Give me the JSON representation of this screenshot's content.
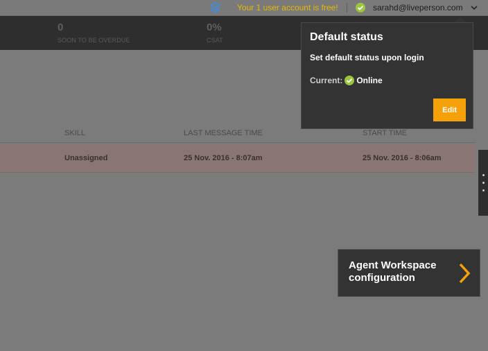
{
  "topbar": {
    "promo_text": "Your 1 user account is free!",
    "user_email": "sarahd@liveperson.com",
    "status_color": "#9bc53d",
    "icons": [
      "layers-icon",
      "status-check-icon",
      "chevron-down-icon"
    ]
  },
  "kpis": [
    {
      "value": "0",
      "label": "SOON TO BE OVERDUE"
    },
    {
      "value": "0%",
      "label": "CSAT"
    }
  ],
  "table": {
    "headers": [
      "SKILL",
      "LAST MESSAGE TIME",
      "START TIME"
    ],
    "rows": [
      {
        "skill": "Unassigned",
        "last_message_time": "25 Nov. 2016 - 8:07am",
        "start_time": "25 Nov. 2016 - 8:06am"
      }
    ]
  },
  "popover": {
    "title": "Default status",
    "subtitle": "Set default status upon login",
    "current_label": "Current:",
    "current_value": "Online",
    "edit_label": "Edit"
  },
  "workspace_card": {
    "label": "Agent Workspace configuration"
  },
  "colors": {
    "accent": "#f5a20a",
    "online": "#9bc53d",
    "promo": "#e6b800",
    "dark_panel": "#333333"
  }
}
